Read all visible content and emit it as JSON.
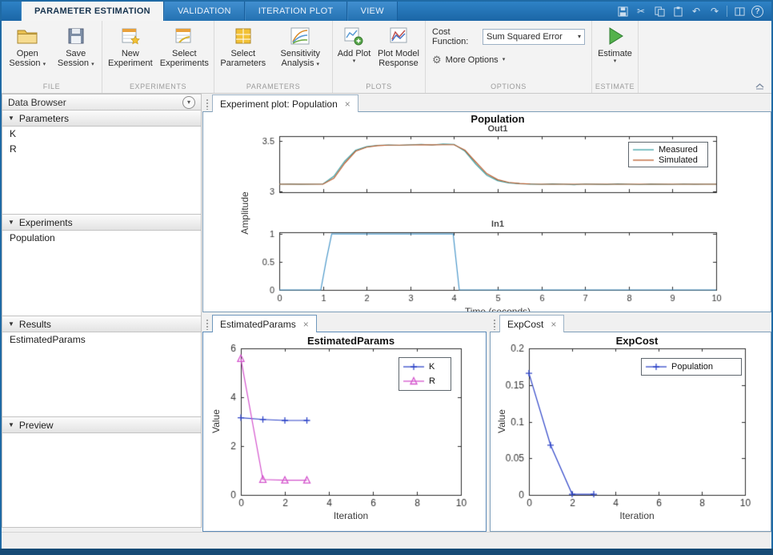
{
  "titlebar": {
    "tabs": [
      {
        "label": "PARAMETER ESTIMATION",
        "active": true
      },
      {
        "label": "VALIDATION",
        "active": false
      },
      {
        "label": "ITERATION PLOT",
        "active": false
      },
      {
        "label": "VIEW",
        "active": false
      }
    ]
  },
  "icons": {
    "caret_down": "▾",
    "gear": "⚙",
    "close": "×",
    "section_triangle": "▼",
    "menu_circle": "▾",
    "cut": "✂",
    "undo": "↶",
    "redo": "↷",
    "help": "?"
  },
  "toolstrip": {
    "file": {
      "section": "FILE",
      "open": "Open Session",
      "save": "Save Session"
    },
    "experiments": {
      "section": "EXPERIMENTS",
      "new": "New Experiment",
      "select": "Select Experiments"
    },
    "parameters": {
      "section": "PARAMETERS",
      "select": "Select Parameters",
      "sensitivity": "Sensitivity Analysis"
    },
    "plots": {
      "section": "PLOTS",
      "add": "Add Plot",
      "model_response": "Plot Model Response"
    },
    "options": {
      "section": "OPTIONS",
      "cost_function_label": "Cost Function:",
      "cost_function_value": "Sum Squared Error",
      "more_options": "More Options"
    },
    "estimate": {
      "section": "ESTIMATE",
      "button": "Estimate"
    }
  },
  "data_browser": {
    "title": "Data Browser",
    "parameters": {
      "label": "Parameters",
      "items": [
        "K",
        "R"
      ]
    },
    "experiments": {
      "label": "Experiments",
      "items": [
        "Population"
      ]
    },
    "results": {
      "label": "Results",
      "items": [
        "EstimatedParams"
      ]
    },
    "preview": {
      "label": "Preview"
    }
  },
  "panels": {
    "experiment": {
      "tab": "Experiment plot: Population"
    },
    "estimated": {
      "tab": "EstimatedParams"
    },
    "expcost": {
      "tab": "ExpCost"
    }
  },
  "chart_data": [
    {
      "id": "experiment-plot",
      "type": "line",
      "title": "Population",
      "ylabel": "Amplitude",
      "xlabel": "Time (seconds)",
      "legend_position": "top-right",
      "grid": false,
      "subplots": [
        {
          "title": "Out1",
          "xlim": [
            0,
            10
          ],
          "ylim": [
            2.99,
            3.55
          ],
          "xticks": [
            0,
            1,
            2,
            3,
            4,
            5,
            6,
            7,
            8,
            9,
            10
          ],
          "show_xtick_labels": false,
          "yticks": [
            3,
            3.5
          ],
          "series": [
            {
              "name": "Measured",
              "color": "#3a9fa4",
              "x": [
                0,
                0.25,
                0.5,
                0.75,
                1,
                1.25,
                1.5,
                1.75,
                2,
                2.25,
                2.5,
                2.75,
                3,
                3.25,
                3.5,
                3.75,
                4,
                4.25,
                4.5,
                4.75,
                5,
                5.25,
                5.5,
                5.75,
                6,
                6.25,
                6.5,
                6.75,
                7,
                7.25,
                7.5,
                7.75,
                8,
                8.25,
                8.5,
                8.75,
                9,
                9.25,
                9.5,
                9.75,
                10
              ],
              "y": [
                3.07,
                3.071,
                3.069,
                3.07,
                3.072,
                3.15,
                3.3,
                3.41,
                3.445,
                3.458,
                3.462,
                3.458,
                3.464,
                3.468,
                3.462,
                3.472,
                3.468,
                3.4,
                3.27,
                3.16,
                3.105,
                3.083,
                3.075,
                3.071,
                3.068,
                3.073,
                3.07,
                3.065,
                3.072,
                3.069,
                3.067,
                3.073,
                3.07,
                3.066,
                3.071,
                3.069,
                3.068,
                3.072,
                3.069,
                3.07,
                3.07
              ]
            },
            {
              "name": "Simulated",
              "color": "#bc5b2b",
              "x": [
                0,
                0.25,
                0.5,
                0.75,
                1,
                1.25,
                1.5,
                1.75,
                2,
                2.25,
                2.5,
                2.75,
                3,
                3.25,
                3.5,
                3.75,
                4,
                4.25,
                4.5,
                4.75,
                5,
                5.25,
                5.5,
                5.75,
                6,
                6.25,
                6.5,
                6.75,
                7,
                7.25,
                7.5,
                7.75,
                8,
                8.25,
                8.5,
                8.75,
                9,
                9.25,
                9.5,
                9.75,
                10
              ],
              "y": [
                3.07,
                3.07,
                3.07,
                3.07,
                3.07,
                3.13,
                3.28,
                3.4,
                3.44,
                3.455,
                3.46,
                3.46,
                3.462,
                3.463,
                3.463,
                3.464,
                3.464,
                3.41,
                3.29,
                3.175,
                3.115,
                3.088,
                3.077,
                3.072,
                3.07,
                3.07,
                3.07,
                3.07,
                3.07,
                3.07,
                3.07,
                3.07,
                3.07,
                3.07,
                3.07,
                3.07,
                3.07,
                3.07,
                3.07,
                3.07,
                3.07
              ]
            }
          ]
        },
        {
          "title": "In1",
          "xlim": [
            0,
            10
          ],
          "ylim": [
            0,
            1.03
          ],
          "xticks": [
            0,
            1,
            2,
            3,
            4,
            5,
            6,
            7,
            8,
            9,
            10
          ],
          "show_xtick_labels": true,
          "yticks": [
            0,
            0.5,
            1
          ],
          "series": [
            {
              "name": "In1",
              "color": "#4a97c9",
              "x": [
                0,
                0.95,
                1.08,
                1.2,
                3.98,
                4.05,
                4.12,
                10
              ],
              "y": [
                0,
                0,
                0.55,
                1,
                1,
                0.5,
                0,
                0
              ]
            }
          ]
        }
      ]
    },
    {
      "id": "estimated-params",
      "type": "line",
      "title": "EstimatedParams",
      "xlabel": "Iteration",
      "ylabel": "Value",
      "xlim": [
        0,
        10
      ],
      "ylim": [
        0,
        6
      ],
      "xticks": [
        0,
        2,
        4,
        6,
        8,
        10
      ],
      "yticks": [
        0,
        2,
        4,
        6
      ],
      "legend_position": "top-right",
      "grid": false,
      "series": [
        {
          "name": "K",
          "color": "#2f45c8",
          "marker": "plus",
          "x": [
            0,
            1,
            2,
            3
          ],
          "y": [
            3.16,
            3.09,
            3.05,
            3.05
          ]
        },
        {
          "name": "R",
          "color": "#d352cc",
          "marker": "triangle",
          "x": [
            0,
            1,
            2,
            3
          ],
          "y": [
            5.58,
            0.63,
            0.6,
            0.6
          ]
        }
      ]
    },
    {
      "id": "exp-cost",
      "type": "line",
      "title": "ExpCost",
      "xlabel": "Iteration",
      "ylabel": "Value",
      "xlim": [
        0,
        10
      ],
      "ylim": [
        0,
        0.2
      ],
      "xticks": [
        0,
        2,
        4,
        6,
        8,
        10
      ],
      "yticks": [
        0,
        0.05,
        0.1,
        0.15,
        0.2
      ],
      "legend_position": "top-right",
      "grid": false,
      "series": [
        {
          "name": "Population",
          "color": "#2f45c8",
          "marker": "plus",
          "x": [
            0,
            1,
            2,
            3
          ],
          "y": [
            0.166,
            0.068,
            0.001,
            0.001
          ]
        }
      ]
    }
  ]
}
